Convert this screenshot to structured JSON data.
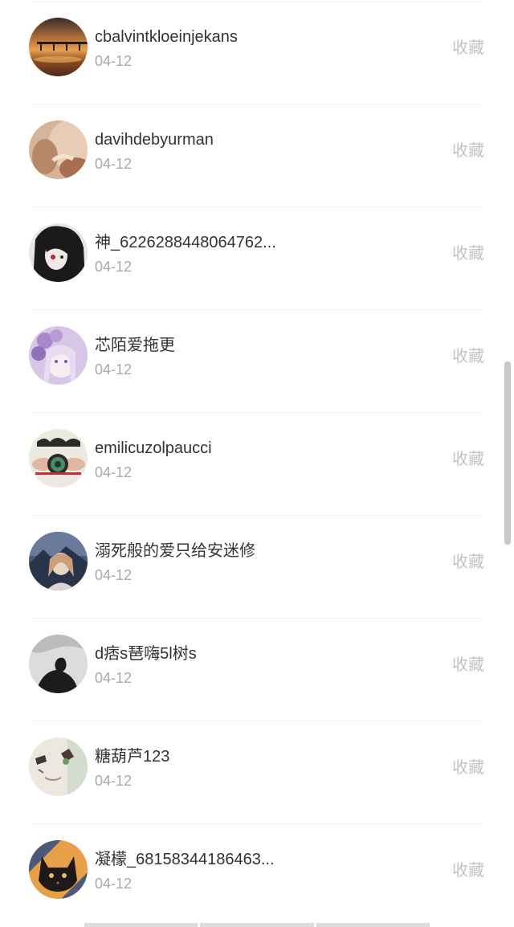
{
  "list": {
    "items": [
      {
        "name": "cbalvintkloeinjekans",
        "date": "04-12",
        "action": "收藏",
        "avatar": "sunset-pier-avatar"
      },
      {
        "name": "davihdebyurman",
        "date": "04-12",
        "action": "收藏",
        "avatar": "warm-toned-photo-avatar"
      },
      {
        "name": "神_6226288448064762...",
        "date": "04-12",
        "action": "收藏",
        "avatar": "dark-hair-anime-avatar"
      },
      {
        "name": "芯陌爱拖更",
        "date": "04-12",
        "action": "收藏",
        "avatar": "purple-anime-girl-avatar"
      },
      {
        "name": "emilicuzolpaucci",
        "date": "04-12",
        "action": "收藏",
        "avatar": "camera-hands-avatar"
      },
      {
        "name": "溺死般的爱只给安迷修",
        "date": "04-12",
        "action": "收藏",
        "avatar": "anime-girl-mountain-avatar"
      },
      {
        "name": "d痞s琶嗨5l树s",
        "date": "04-12",
        "action": "收藏",
        "avatar": "monochrome-silhouette-avatar"
      },
      {
        "name": "糖葫芦123",
        "date": "04-12",
        "action": "收藏",
        "avatar": "sketch-face-avatar"
      },
      {
        "name": "凝檬_68158344186463...",
        "date": "04-12",
        "action": "收藏",
        "avatar": "black-cat-orange-avatar"
      }
    ]
  },
  "colors": {
    "name_text": "#333333",
    "date_text": "#a8a8a8",
    "action_text": "#c3c3c3",
    "divider": "#f2f2f2",
    "scrollbar": "#c8c8c8"
  }
}
